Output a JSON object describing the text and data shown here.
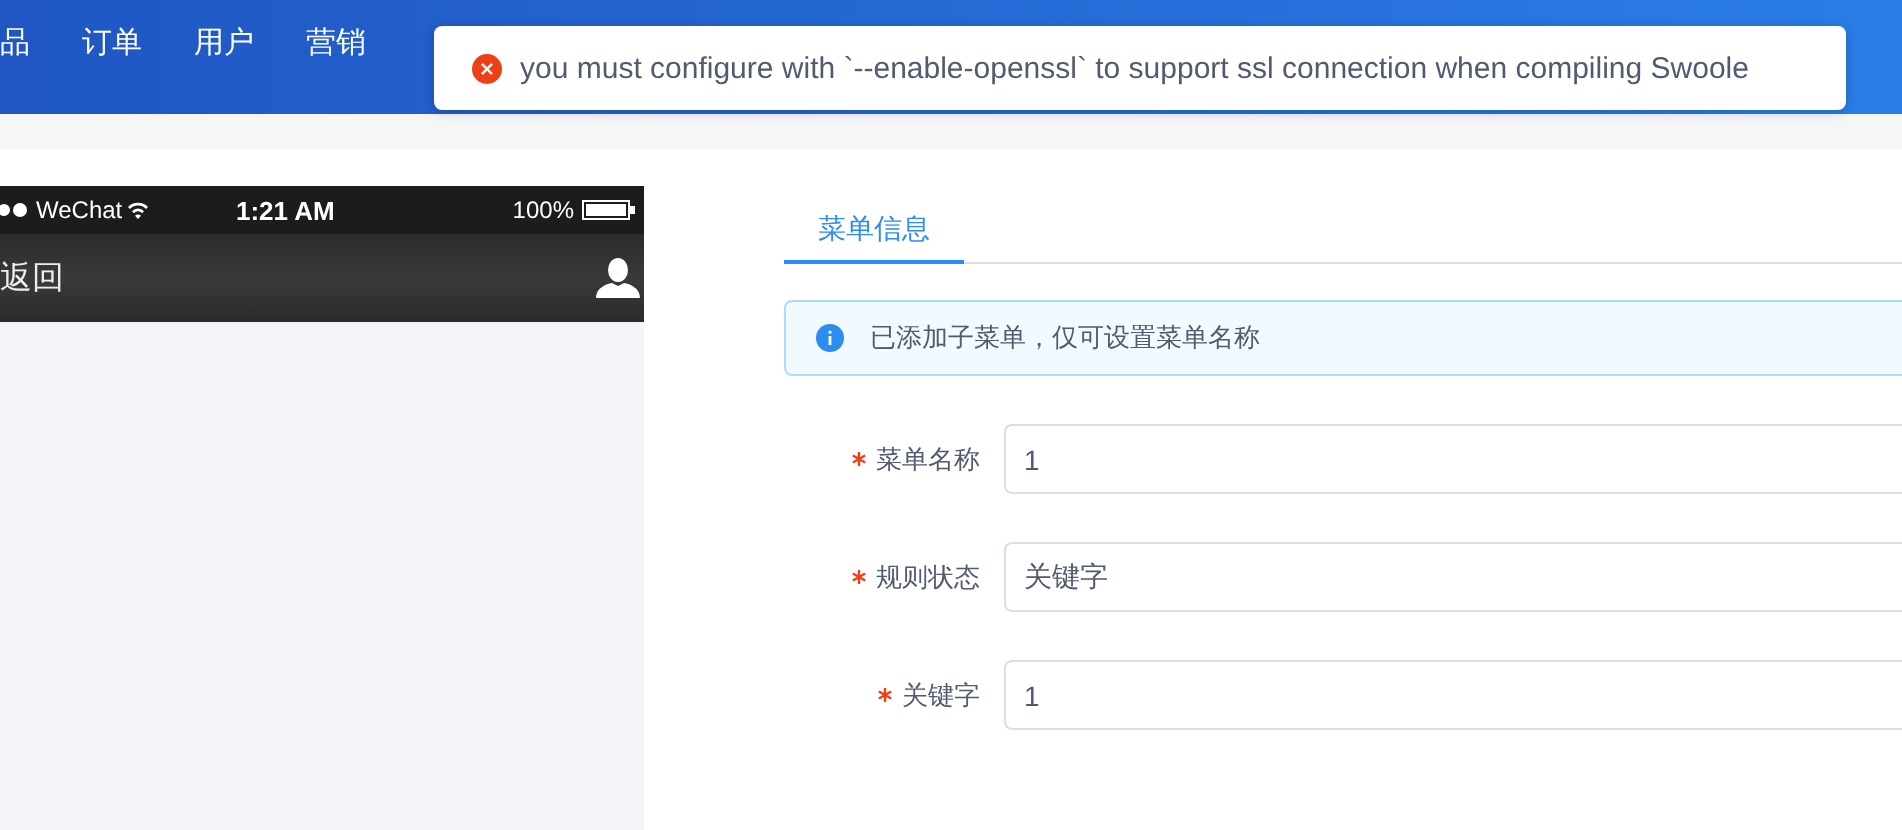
{
  "top_nav": {
    "items": [
      {
        "label": "品"
      },
      {
        "label": "订单"
      },
      {
        "label": "用户"
      },
      {
        "label": "营销"
      }
    ]
  },
  "toast": {
    "kind": "error",
    "message": "you must configure with `--enable-openssl` to support ssl connection when compiling Swoole"
  },
  "phone_preview": {
    "status_bar": {
      "carrier": "WeChat",
      "time": "1:21 AM",
      "battery": "100%"
    },
    "nav_bar": {
      "back": "返回"
    }
  },
  "tabs": [
    {
      "label": "菜单信息",
      "selected": true
    }
  ],
  "alert": {
    "kind": "info",
    "text": "已添加子菜单，仅可设置菜单名称"
  },
  "form": {
    "fields": [
      {
        "label": "菜单名称",
        "required": true,
        "value": "1"
      },
      {
        "label": "规则状态",
        "required": true,
        "value": "关键字"
      },
      {
        "label": "关键字",
        "required": true,
        "value": "1"
      }
    ]
  }
}
